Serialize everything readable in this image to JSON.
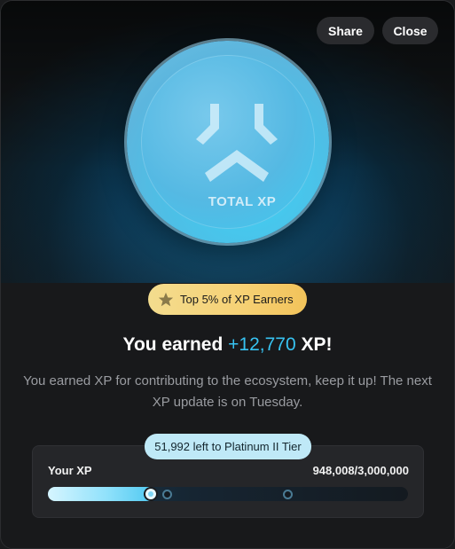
{
  "header": {
    "share_label": "Share",
    "close_label": "Close"
  },
  "coin": {
    "label": "TOTAL XP",
    "icon": "total-xp-logo"
  },
  "badge": {
    "icon": "star-icon",
    "text": "Top 5% of XP Earners"
  },
  "title": {
    "prefix": "You earned ",
    "amount": "+12,770",
    "suffix": " XP!"
  },
  "description": "You earned XP for contributing to the ecosystem, keep it up! The next XP update is on Tuesday.",
  "xp": {
    "label": "Your XP",
    "value": "948,008/3,000,000",
    "tooltip": "51,992 left to Platinum II Tier",
    "progress_fraction": 0.3,
    "milestones": [
      0.33,
      0.665
    ]
  },
  "colors": {
    "accent": "#37c3f2",
    "badge_gold": "#f3d27a",
    "background": "#18191b"
  }
}
